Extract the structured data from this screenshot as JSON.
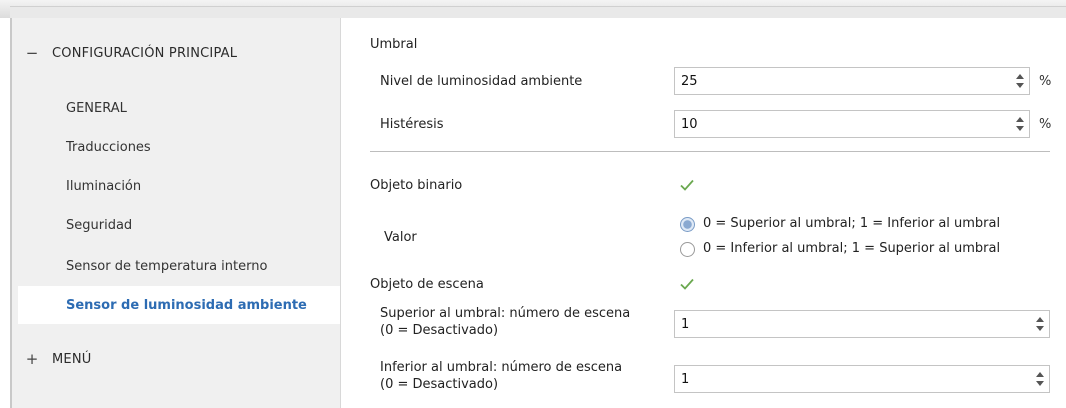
{
  "sidebar": {
    "sections": [
      {
        "sign": "−",
        "title": "CONFIGURACIÓN PRINCIPAL"
      },
      {
        "sign": "+",
        "title": "MENÚ"
      }
    ],
    "items": [
      {
        "label": "GENERAL"
      },
      {
        "label": "Traducciones"
      },
      {
        "label": "Iluminación"
      },
      {
        "label": "Seguridad"
      },
      {
        "label": "Sensor de temperatura interno"
      },
      {
        "label": "Sensor de luminosidad ambiente"
      }
    ],
    "active_item": "Sensor de luminosidad ambiente"
  },
  "main": {
    "umbral_heading": "Umbral",
    "nivel": {
      "label": "Nivel de luminosidad ambiente",
      "value": "25",
      "unit": "%"
    },
    "histeresis": {
      "label": "Histéresis",
      "value": "10",
      "unit": "%"
    },
    "objeto_binario": {
      "label": "Objeto binario",
      "checked": true
    },
    "valor": {
      "label": "Valor",
      "options": [
        "0 = Superior al umbral; 1 = Inferior al umbral",
        "0 = Inferior al umbral; 1 = Superior al umbral"
      ],
      "selected_index": 0
    },
    "objeto_escena": {
      "label": "Objeto de escena",
      "checked": true
    },
    "superior": {
      "label_line1": "Superior al umbral: número de escena",
      "label_line2": "(0 = Desactivado)",
      "value": "1"
    },
    "inferior": {
      "label_line1": "Inferior al umbral: número de escena",
      "label_line2": "(0 = Desactivado)",
      "value": "1"
    }
  },
  "colors": {
    "active_item": "#2d6cb3",
    "check": "#6aa84f",
    "sidebar_bg": "#f0f0f0"
  }
}
